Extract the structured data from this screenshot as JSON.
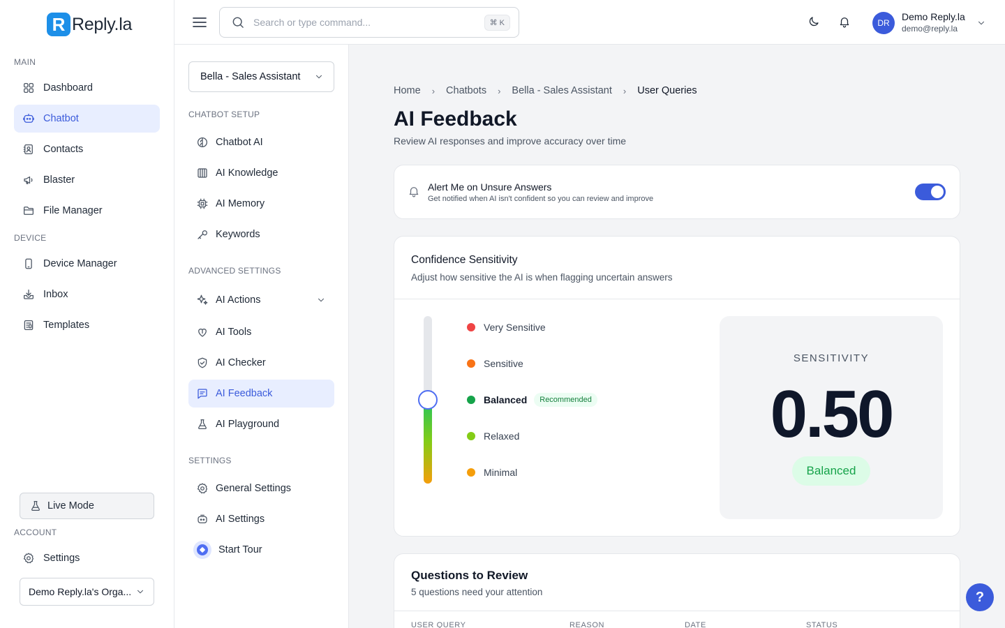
{
  "brand": {
    "logo_letter": "R",
    "name": "Reply.la"
  },
  "sidebar": {
    "sections": {
      "main": "MAIN",
      "device": "DEVICE",
      "account": "ACCOUNT"
    },
    "items": [
      {
        "label": "Dashboard",
        "icon": "grid-icon"
      },
      {
        "label": "Chatbot",
        "icon": "bot-icon",
        "active": true
      },
      {
        "label": "Contacts",
        "icon": "contacts-icon"
      },
      {
        "label": "Blaster",
        "icon": "megaphone-icon"
      },
      {
        "label": "File Manager",
        "icon": "folder-icon"
      },
      {
        "label": "Device Manager",
        "icon": "phone-icon"
      },
      {
        "label": "Inbox",
        "icon": "inbox-icon"
      },
      {
        "label": "Templates",
        "icon": "templates-icon"
      }
    ],
    "live_mode": "Live Mode",
    "settings": "Settings",
    "org": "Demo Reply.la's Orga..."
  },
  "topbar": {
    "search_placeholder": "Search or type command...",
    "shortcut": "⌘ K",
    "user_initials": "DR",
    "user_name": "Demo Reply.la",
    "user_email": "demo@reply.la"
  },
  "panel": {
    "bot_select": "Bella - Sales Assistant",
    "sections": {
      "setup": "CHATBOT SETUP",
      "advanced": "ADVANCED SETTINGS",
      "settings": "SETTINGS"
    },
    "items": [
      {
        "label": "Chatbot AI",
        "icon": "brain-icon"
      },
      {
        "label": "AI Knowledge",
        "icon": "book-icon"
      },
      {
        "label": "AI Memory",
        "icon": "chip-icon"
      },
      {
        "label": "Keywords",
        "icon": "key-icon"
      },
      {
        "label": "AI Actions",
        "icon": "sparkle-icon"
      },
      {
        "label": "AI Tools",
        "icon": "tools-icon"
      },
      {
        "label": "AI Checker",
        "icon": "shield-check-icon"
      },
      {
        "label": "AI Feedback",
        "icon": "feedback-icon",
        "active": true
      },
      {
        "label": "AI Playground",
        "icon": "flask-icon"
      },
      {
        "label": "General Settings",
        "icon": "gear-icon"
      },
      {
        "label": "AI Settings",
        "icon": "robot-icon"
      },
      {
        "label": "Start Tour",
        "icon": "compass-icon"
      }
    ]
  },
  "breadcrumb": [
    "Home",
    "Chatbots",
    "Bella - Sales Assistant",
    "User Queries"
  ],
  "page": {
    "title": "AI Feedback",
    "subtitle": "Review AI responses and improve accuracy over time"
  },
  "alert": {
    "title": "Alert Me on Unsure Answers",
    "description": "Get notified when AI isn't confident so you can review and improve",
    "enabled": true
  },
  "confidence": {
    "title": "Confidence Sensitivity",
    "description": "Adjust how sensitive the AI is when flagging uncertain answers",
    "levels": [
      {
        "label": "Very Sensitive",
        "color": "#ef4444"
      },
      {
        "label": "Sensitive",
        "color": "#f97316"
      },
      {
        "label": "Balanced",
        "color": "#16a34a",
        "badge": "Recommended",
        "selected": true
      },
      {
        "label": "Relaxed",
        "color": "#84cc16"
      },
      {
        "label": "Minimal",
        "color": "#f59e0b"
      }
    ],
    "slider_value": 0.5,
    "sensitivity_label": "SENSITIVITY",
    "sensitivity_value": "0.50",
    "sensitivity_badge": "Balanced"
  },
  "questions": {
    "title": "Questions to Review",
    "description": "5 questions need your attention",
    "columns": [
      "USER QUERY",
      "REASON",
      "DATE",
      "STATUS"
    ]
  },
  "help": "?"
}
